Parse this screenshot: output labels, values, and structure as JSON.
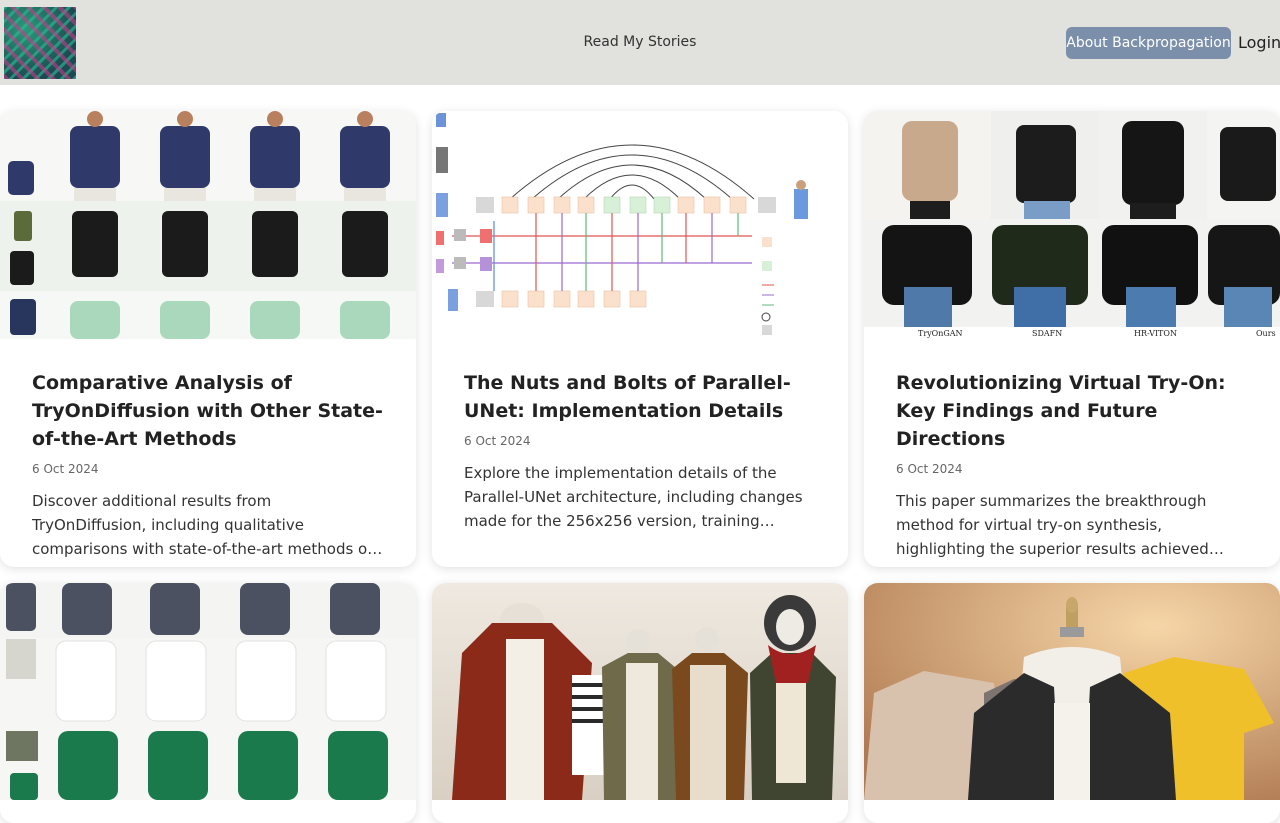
{
  "nav": {
    "stories_label": "Read My Stories",
    "about_label": "About Backpropagation",
    "login_label": "Login"
  },
  "colors": {
    "topbar": "#e1e1de",
    "about_button": "#7b8faa"
  },
  "cards": [
    {
      "title": "Comparative Analysis of TryOnDiffusion with Other State-of-the-Art Methods",
      "date": "6 Oct 2024",
      "description": "Discover additional results from TryOnDiffusion, including qualitative comparisons with state-of-the-art methods on challenging and insights from the study."
    },
    {
      "title": "The Nuts and Bolts of Parallel-UNet: Implementation Details",
      "date": "6 Oct 2024",
      "description": "Explore the implementation details of the Parallel-UNet architecture, including changes made for the 256x256 version, training methodologies and more."
    },
    {
      "title": "Revolutionizing Virtual Try-On: Key Findings and Future Directions",
      "date": "6 Oct 2024",
      "description": "This paper summarizes the breakthrough method for virtual try-on synthesis, highlighting the superior results achieved through the Parallel-UNet."
    },
    {
      "title": "",
      "date": "",
      "description": ""
    },
    {
      "title": "",
      "date": "",
      "description": ""
    },
    {
      "title": "",
      "date": "",
      "description": ""
    }
  ],
  "thumb_captions": {
    "card3": [
      "TryOnGAN",
      "SDAFN",
      "HR-VITON",
      "Ours"
    ]
  }
}
